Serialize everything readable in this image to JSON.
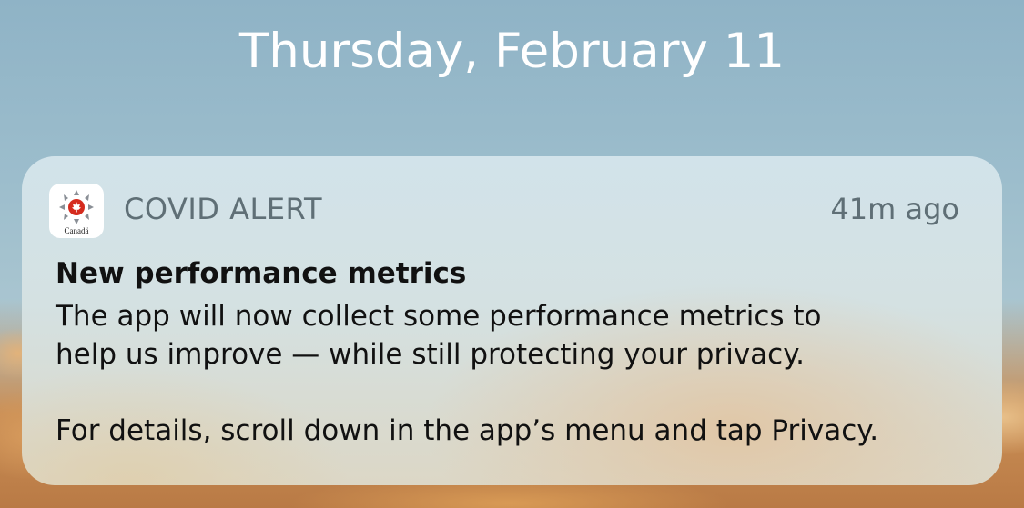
{
  "lock_screen": {
    "date": "Thursday, February 11"
  },
  "notification": {
    "app_name": "COVID ALERT",
    "time_ago": "41m ago",
    "icon": {
      "name": "covid-alert-app-icon",
      "wordmark": "Canadä",
      "accent_color": "#d52b1e"
    },
    "title": "New performance metrics",
    "body_lines": [
      "The app will now collect some performance metrics to\nhelp us improve — while still protecting your privacy.",
      "For details, scroll down in the app’s menu and tap Privacy."
    ]
  }
}
